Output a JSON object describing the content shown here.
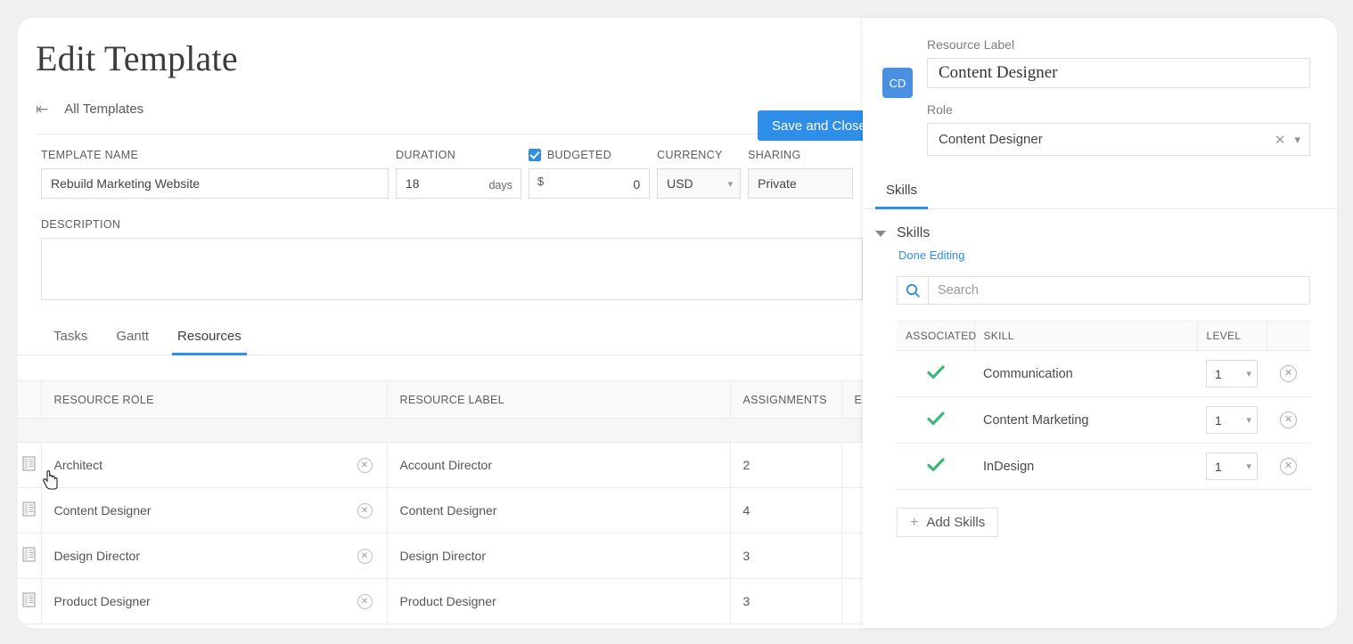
{
  "header": {
    "title": "Edit Template",
    "back_link": "All Templates",
    "back_icon": "back-arrow-icon",
    "save_button": "Save and Close"
  },
  "form": {
    "template_name": {
      "label": "TEMPLATE NAME",
      "value": "Rebuild Marketing Website"
    },
    "duration": {
      "label": "DURATION",
      "value": "18",
      "unit": "days"
    },
    "budgeted": {
      "label": "BUDGETED",
      "checked": true,
      "currency_symbol": "$",
      "value": "0"
    },
    "currency": {
      "label": "CURRENCY",
      "value": "USD"
    },
    "sharing": {
      "label": "SHARING",
      "value": "Private"
    },
    "description": {
      "label": "DESCRIPTION",
      "value": ""
    }
  },
  "tabs": [
    {
      "label": "Tasks",
      "active": false
    },
    {
      "label": "Gantt",
      "active": false
    },
    {
      "label": "Resources",
      "active": true
    }
  ],
  "resource_table": {
    "columns": [
      "RESOURCE ROLE",
      "RESOURCE LABEL",
      "ASSIGNMENTS",
      "EST"
    ],
    "rows": [
      {
        "role": "Architect",
        "label": "Account Director",
        "assignments": "2"
      },
      {
        "role": "Content Designer",
        "label": "Content Designer",
        "assignments": "4"
      },
      {
        "role": "Design Director",
        "label": "Design Director",
        "assignments": "3"
      },
      {
        "role": "Product Designer",
        "label": "Product Designer",
        "assignments": "3"
      }
    ]
  },
  "panel": {
    "avatar_initials": "CD",
    "resource_label": {
      "label": "Resource Label",
      "value": "Content Designer"
    },
    "role": {
      "label": "Role",
      "value": "Content Designer"
    },
    "tab": {
      "label": "Skills",
      "active": true
    },
    "section_title": "Skills",
    "done_editing": "Done Editing",
    "search_placeholder": "Search",
    "search_value": "",
    "skills_table": {
      "columns": [
        "ASSOCIATED",
        "SKILL",
        "LEVEL",
        ""
      ],
      "rows": [
        {
          "associated": true,
          "skill": "Communication",
          "level": "1"
        },
        {
          "associated": true,
          "skill": "Content Marketing",
          "level": "1"
        },
        {
          "associated": true,
          "skill": "InDesign",
          "level": "1"
        }
      ]
    },
    "add_skills_button": "Add Skills"
  },
  "colors": {
    "accent_blue": "#2e8ee8",
    "avatar_blue": "#4a90e2",
    "check_green": "#3cb878",
    "page_bg": "#f0f0f0"
  }
}
